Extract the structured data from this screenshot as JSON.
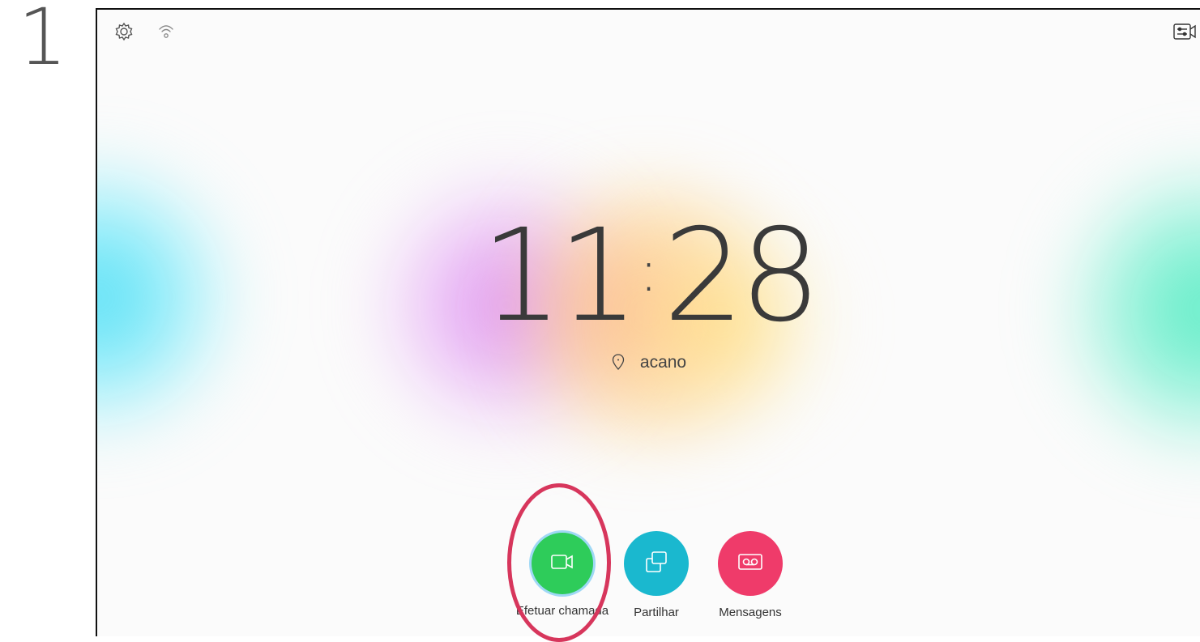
{
  "step": "1",
  "clock": {
    "hours": "11",
    "minutes": "28"
  },
  "location": {
    "name": "acano"
  },
  "actions": [
    {
      "label": "Efetuar chamada",
      "color": "#2ecc5a",
      "icon": "video-camera-icon"
    },
    {
      "label": "Partilhar",
      "color": "#1ab8cf",
      "icon": "share-screen-icon"
    },
    {
      "label": "Mensagens",
      "color": "#ef3b6a",
      "icon": "voicemail-icon"
    }
  ],
  "colors": {
    "highlight": "#d7365c"
  }
}
